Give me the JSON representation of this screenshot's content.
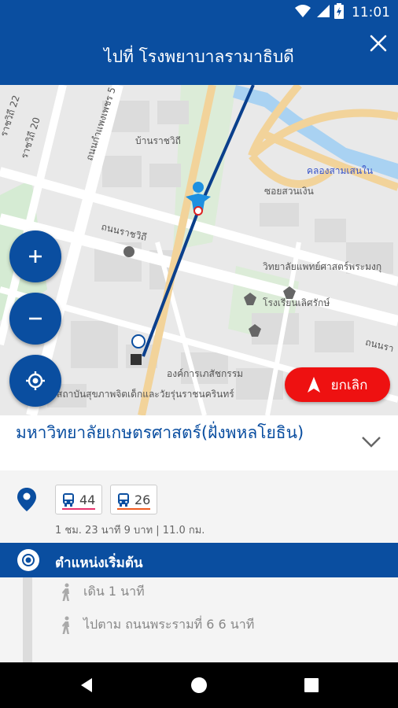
{
  "status_bar": {
    "time": "11:01",
    "icons": [
      "wifi-icon",
      "cellular-signal-icon",
      "battery-icon"
    ]
  },
  "header": {
    "title": "ไปที่ โรงพยาบาลรามาธิบดี",
    "close_icon": "close-icon"
  },
  "map": {
    "labels": {
      "soi_22": "ราชวิถี 22",
      "soi_20": "ราชวิถี 20",
      "phetchaburi": "ถนนกำแพงเพชร 5",
      "ban_ratchawithi": "บ้านราชวิถี",
      "khlong": "คลองสามเสนใน",
      "soi_suan_ngoen": "ซอยสวนเงิน",
      "thanon_ratchawithi": "ถนนราชวิถี",
      "college": "วิทยาลัยแพทย์ศาสตร์พระมงกุ",
      "school": "โรงเรียนเลิศรักษ์",
      "thanon_rama": "ถนนรา",
      "org": "องค์การเภสัชกรรม",
      "institute": "สถาบันสุขภาพจิตเด็กและวัยรุ่นราชนครินทร์"
    },
    "controls": {
      "zoom_in_icon": "plus-icon",
      "zoom_out_icon": "minus-icon",
      "locate_icon": "my-location-icon"
    },
    "cancel_label": "ยกเลิก"
  },
  "place": {
    "name": "มหาวิทยาลัยเกษตรศาสตร์(ฝั่งพหลโยธิน)"
  },
  "route": {
    "buses": [
      {
        "number": "44",
        "color": "#e8336d"
      },
      {
        "number": "26",
        "color": "#f05a1e"
      }
    ],
    "meta": "1 ชม. 23 นาที  9 บาท | 11.0 กม."
  },
  "steps": {
    "start_label": "ตำแหน่งเริ่มต้น",
    "items": [
      {
        "icon": "walk-icon",
        "text": "เดิน 1 นาที"
      },
      {
        "icon": "walk-icon",
        "text": "ไปตาม ถนนพระรามที่ 6 6 นาที"
      }
    ]
  },
  "colors": {
    "primary": "#0a4ea0",
    "cancel": "#ee1111",
    "panel_bg": "#f4f4f4"
  }
}
